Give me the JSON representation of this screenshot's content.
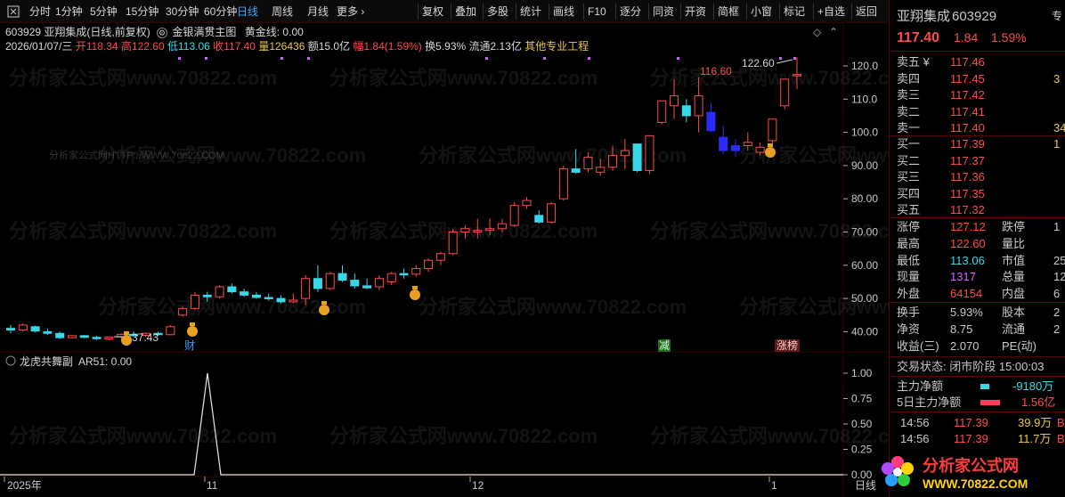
{
  "toolbar": {
    "left_items": [
      "分时",
      "1分钟",
      "5分钟",
      "15分钟",
      "30分钟",
      "60分钟",
      "日线",
      "周线",
      "月线",
      "更多 ›"
    ],
    "active_item": "日线",
    "right_items": [
      "复权",
      "叠加",
      "多股",
      "统计",
      "画线",
      "F10",
      "逐分",
      "同资",
      "开资",
      "简框",
      "小窗",
      "标记",
      "+自选",
      "返回"
    ]
  },
  "header": {
    "stock_title": "603929 亚翔集成(日线,前复权)",
    "indicator_name": "金银满贯主图",
    "indicator_value": "黄金线: 0.00",
    "date": "2026/01/07/三",
    "open": "开118.34",
    "high": "高122.60",
    "low": "低113.06",
    "close": "收117.40",
    "volume": "量126436",
    "amount": "额15.0亿",
    "change": "幅1.84(1.59%)",
    "turnover": "换5.93%",
    "float": "流通2.13亿",
    "industry": "其他专业工程"
  },
  "chart_data": {
    "type": "candlestick",
    "y_ticks": [
      "120.0",
      "110.0",
      "100.0",
      "90.00",
      "80.00",
      "70.00",
      "60.00",
      "50.00",
      "40.00"
    ],
    "x_labels": [
      "2025年",
      "11",
      "12",
      "1"
    ],
    "annotations": {
      "max_label": "116.60",
      "max2_label": "122.60",
      "min_label": "37.43",
      "marker_cai": "财",
      "marker_jian": "减",
      "marker_zhangbang": "涨榜"
    },
    "candles": [
      [
        41,
        42,
        39.5,
        40.5
      ],
      [
        40.5,
        42.5,
        40,
        42
      ],
      [
        41.5,
        41.8,
        39.8,
        40.2
      ],
      [
        40,
        41,
        39,
        39.5
      ],
      [
        39.5,
        40,
        37.8,
        38.2
      ],
      [
        38.2,
        39,
        37.9,
        38.8
      ],
      [
        38.8,
        39,
        38,
        38.3
      ],
      [
        38.3,
        38.8,
        37.5,
        38
      ],
      [
        37.8,
        38.6,
        37.43,
        38.4
      ],
      [
        38.4,
        39.5,
        38,
        39.2
      ],
      [
        39.2,
        40,
        38.6,
        38.9
      ],
      [
        38.9,
        39.8,
        38.5,
        39.5
      ],
      [
        39.5,
        40,
        38.8,
        39.1
      ],
      [
        39.1,
        42,
        39,
        41.5
      ],
      [
        45,
        47.5,
        44.5,
        47
      ],
      [
        47,
        52,
        46.5,
        51
      ],
      [
        51,
        52,
        49,
        50.5
      ],
      [
        50.5,
        54,
        50,
        53.5
      ],
      [
        53.5,
        54.5,
        51.5,
        52
      ],
      [
        52,
        53,
        50.5,
        51
      ],
      [
        51,
        52,
        50,
        50.3
      ],
      [
        50.3,
        51.5,
        49.5,
        50
      ],
      [
        50,
        51,
        48.5,
        49
      ],
      [
        49,
        51.5,
        48.5,
        49.5
      ],
      [
        50,
        57,
        48,
        56
      ],
      [
        56,
        60,
        52,
        53
      ],
      [
        53,
        58,
        52.5,
        57.5
      ],
      [
        57.5,
        60,
        55,
        55.5
      ],
      [
        55.5,
        57.5,
        53,
        53.8
      ],
      [
        53.8,
        56,
        52.8,
        53.2
      ],
      [
        53.5,
        57,
        52.5,
        56
      ],
      [
        55,
        58,
        54,
        57.5
      ],
      [
        57.5,
        59,
        56,
        57.3
      ],
      [
        57.3,
        60,
        56.5,
        59
      ],
      [
        59,
        62,
        58,
        61.5
      ],
      [
        61.5,
        64,
        60,
        63.5
      ],
      [
        63.5,
        71,
        63,
        70
      ],
      [
        70,
        72,
        68,
        71
      ],
      [
        70,
        74,
        68,
        70.5
      ],
      [
        70.5,
        74,
        69,
        71
      ],
      [
        71,
        74,
        70,
        72.5
      ],
      [
        72,
        79,
        71.5,
        78
      ],
      [
        78,
        80.5,
        77,
        79.5
      ],
      [
        75,
        76.5,
        72.5,
        73
      ],
      [
        73,
        79,
        72.5,
        78.5
      ],
      [
        80,
        90,
        79.5,
        89
      ],
      [
        89,
        95,
        87.5,
        88
      ],
      [
        89,
        94,
        88,
        92.5
      ],
      [
        88,
        92,
        87,
        89.5
      ],
      [
        89.5,
        96,
        88.5,
        93
      ],
      [
        93,
        98,
        89,
        94.5
      ],
      [
        96.5,
        96,
        88,
        88.5
      ],
      [
        88.5,
        99,
        87.5,
        99
      ],
      [
        103,
        106,
        102.5,
        109.5
      ],
      [
        108,
        116,
        104,
        111
      ],
      [
        108,
        110,
        103,
        105
      ],
      [
        105,
        116.6,
        100,
        111
      ],
      [
        106,
        109,
        100,
        100.5
      ],
      [
        98.5,
        102,
        93.5,
        94.5
      ],
      [
        96,
        98,
        92.5,
        94.5
      ],
      [
        96,
        100,
        94.5,
        97
      ],
      [
        94,
        97,
        93,
        95.5
      ],
      [
        97.5,
        99,
        96.5,
        104
      ],
      [
        108,
        116,
        107,
        116
      ],
      [
        117.4,
        122.6,
        113.06,
        117.4
      ]
    ],
    "sub_indicator": {
      "name": "龙虎共舞副",
      "value": "AR51: 0.00",
      "y_ticks": [
        "1.00",
        "0.75",
        "0.50",
        "0.25",
        "0.00"
      ]
    }
  },
  "quote": {
    "name": "亚翔集成",
    "code": "603929",
    "tab": "专",
    "price": "117.40",
    "change": "1.84",
    "pct": "1.59%",
    "asks": [
      {
        "label": "卖五 ¥",
        "price": "117.46",
        "vol": ""
      },
      {
        "label": "卖四",
        "price": "117.45",
        "vol": "3"
      },
      {
        "label": "卖三",
        "price": "117.42",
        "vol": ""
      },
      {
        "label": "卖二",
        "price": "117.41",
        "vol": ""
      },
      {
        "label": "卖一",
        "price": "117.40",
        "vol": "34"
      }
    ],
    "bids": [
      {
        "label": "买一",
        "price": "117.39",
        "vol": "1"
      },
      {
        "label": "买二",
        "price": "117.37",
        "vol": ""
      },
      {
        "label": "买三",
        "price": "117.36",
        "vol": ""
      },
      {
        "label": "买四",
        "price": "117.35",
        "vol": ""
      },
      {
        "label": "买五",
        "price": "117.32",
        "vol": ""
      }
    ],
    "stats": [
      {
        "l1": "涨停",
        "v1": "127.12",
        "l2": "跌停",
        "v2": "1"
      },
      {
        "l1": "最高",
        "v1": "122.60",
        "l2": "量比",
        "v2": ""
      },
      {
        "l1": "最低",
        "v1": "113.06",
        "l2": "市值",
        "v2": "25"
      },
      {
        "l1": "现量",
        "v1": "1317",
        "l2": "总量",
        "v2": "12"
      },
      {
        "l1": "外盘",
        "v1": "64154",
        "l2": "内盘",
        "v2": "6"
      }
    ],
    "stats2": [
      {
        "l1": "换手",
        "v1": "5.93%",
        "l2": "股本",
        "v2": "2"
      },
      {
        "l1": "净资",
        "v1": "8.75",
        "l2": "流通",
        "v2": "2"
      },
      {
        "l1": "收益(三)",
        "v1": "2.070",
        "l2": "PE(动)",
        "v2": ""
      }
    ],
    "status": "交易状态: 闭市阶段 15:00:03",
    "main_flow_label": "主力净额",
    "main_flow_value": "-9180万",
    "main_flow5_label": "5日主力净额",
    "main_flow5_value": "1.56亿",
    "ticks": [
      {
        "time": "14:56",
        "price": "117.39",
        "vol": "39.9万",
        "flag": "B"
      },
      {
        "time": "14:56",
        "price": "117.39",
        "vol": "11.7万",
        "flag": "B"
      }
    ]
  },
  "logo": {
    "title": "分析家公式网",
    "url": "WWW.70822.COM"
  },
  "watermarks": {
    "site_repeat": "分析家公式网www.70822.com",
    "site_small": "分析家公式网HTTP://WWW.70822.COM"
  },
  "footer": {
    "period_button": "日线"
  },
  "colors": {
    "up": "#ff4b4b",
    "down": "#39d8e8",
    "blue_candle": "#2a2aff",
    "grid": "#3a0000"
  }
}
